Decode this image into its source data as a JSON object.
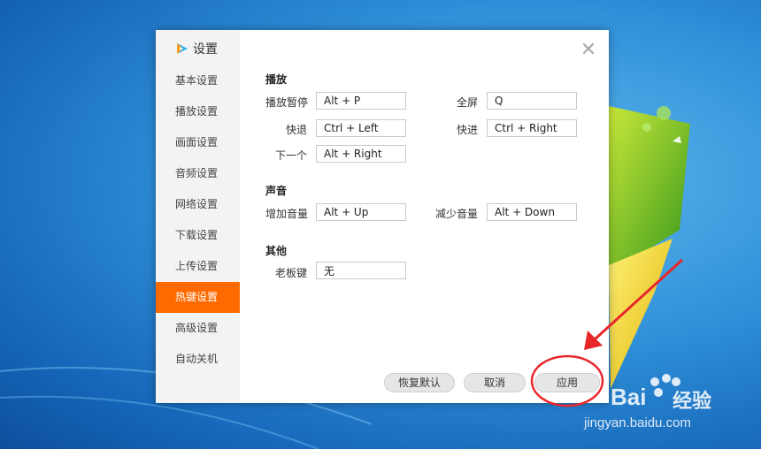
{
  "window": {
    "title": "设置"
  },
  "sidebar": {
    "items": [
      {
        "label": "基本设置"
      },
      {
        "label": "播放设置"
      },
      {
        "label": "画面设置"
      },
      {
        "label": "音频设置"
      },
      {
        "label": "网络设置"
      },
      {
        "label": "下载设置"
      },
      {
        "label": "上传设置"
      },
      {
        "label": "热键设置",
        "active": true
      },
      {
        "label": "高级设置"
      },
      {
        "label": "自动关机"
      }
    ]
  },
  "sections": {
    "play": {
      "title": "播放",
      "fields": [
        {
          "label": "播放暂停",
          "value": "Alt + P"
        },
        {
          "label": "全屏",
          "value": "Q"
        },
        {
          "label": "快退",
          "value": "Ctrl + Left"
        },
        {
          "label": "快进",
          "value": "Ctrl + Right"
        },
        {
          "label": "下一个",
          "value": "Alt + Right"
        }
      ]
    },
    "sound": {
      "title": "声音",
      "fields": [
        {
          "label": "增加音量",
          "value": "Alt + Up"
        },
        {
          "label": "减少音量",
          "value": "Alt + Down"
        }
      ]
    },
    "other": {
      "title": "其他",
      "fields": [
        {
          "label": "老板键",
          "value": "无"
        }
      ]
    }
  },
  "buttons": {
    "restore": "恢复默认",
    "cancel": "取消",
    "apply": "应用"
  },
  "close_icon": "close-icon",
  "watermark": {
    "brand": "Bai",
    "brand_cn": "经验",
    "url": "jingyan.baidu.com"
  },
  "colors": {
    "accent": "#ff6a00",
    "annotation": "#e8262a"
  }
}
